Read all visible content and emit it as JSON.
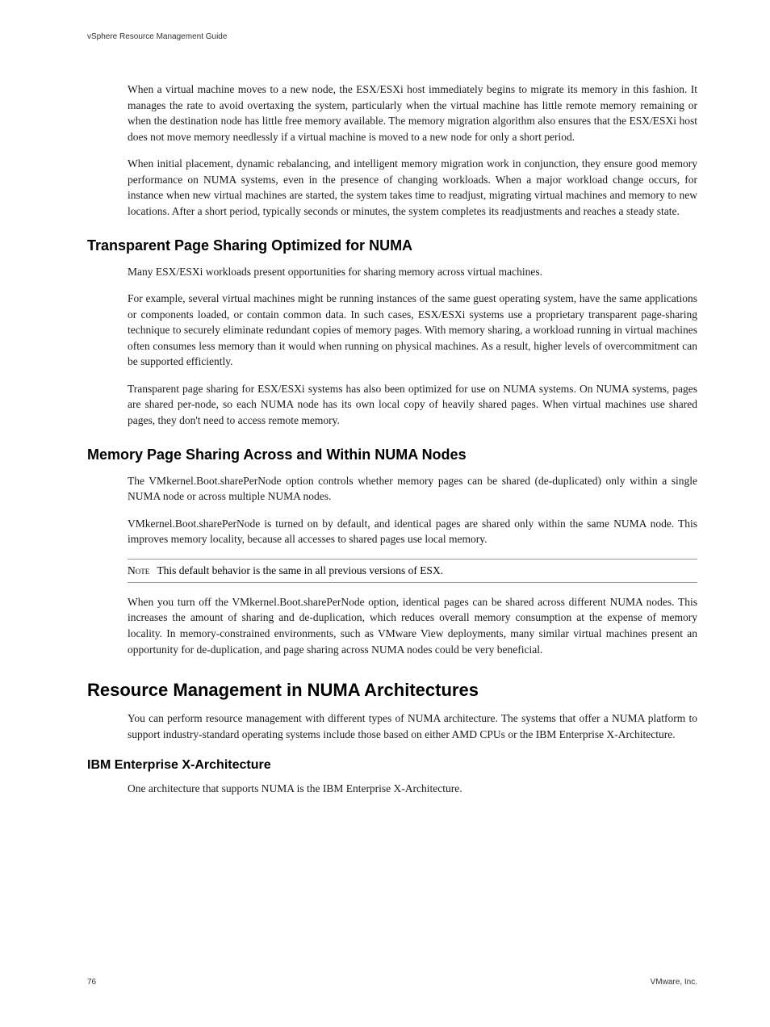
{
  "header": {
    "title": "vSphere Resource Management Guide"
  },
  "body": {
    "para1": "When a virtual machine moves to a new node, the ESX/ESXi host immediately begins to migrate its memory in this fashion. It manages the rate to avoid overtaxing the system, particularly when the virtual machine has little remote memory remaining or when the destination node has little free memory available. The memory migration algorithm also ensures that the ESX/ESXi host does not move memory needlessly if a virtual machine is moved to a new node for only a short period.",
    "para2": "When initial placement, dynamic rebalancing, and intelligent memory migration work in conjunction, they ensure good memory performance on NUMA systems, even in the presence of changing workloads. When a major workload change occurs, for instance when new virtual machines are started, the system takes time to readjust, migrating virtual machines and memory to new locations. After a short period, typically seconds or minutes, the system completes its readjustments and reaches a steady state.",
    "heading1": "Transparent Page Sharing Optimized for NUMA",
    "para3": "Many ESX/ESXi workloads present opportunities for sharing memory across virtual machines.",
    "para4": "For example, several virtual machines might be running instances of the same guest operating system, have the same applications or components loaded, or contain common data. In such cases, ESX/ESXi systems use a proprietary transparent page-sharing technique to securely eliminate redundant copies of memory pages. With memory sharing, a workload running in virtual machines often consumes less memory than it would when running on physical machines. As a result, higher levels of overcommitment can be supported efficiently.",
    "para5": "Transparent page sharing for ESX/ESXi systems has also been optimized for use on NUMA systems. On NUMA systems, pages are shared per-node, so each NUMA node has its own local copy of heavily shared pages. When virtual machines use shared pages, they don't need to access remote memory.",
    "heading2": "Memory Page Sharing Across and Within NUMA Nodes",
    "para6": "The VMkernel.Boot.sharePerNode option controls whether memory pages can be shared (de-duplicated) only within a single NUMA node or across multiple NUMA nodes.",
    "para7": "VMkernel.Boot.sharePerNode is turned on by default, and identical pages are shared only within the same NUMA node. This improves memory locality, because all accesses to shared pages use local memory.",
    "note_label": "Note",
    "note_text": "This default behavior is the same in all previous versions of ESX.",
    "para8": "When you turn off the VMkernel.Boot.sharePerNode option, identical pages can be shared across different NUMA nodes. This increases the amount of sharing and de-duplication, which reduces overall memory consumption at the expense of memory locality. In memory-constrained environments, such as VMware View deployments, many similar virtual machines present an opportunity for de-duplication, and page sharing across NUMA nodes could be very beneficial.",
    "heading3": "Resource Management in NUMA Architectures",
    "para9": "You can perform resource management with different types of NUMA architecture. The systems that offer a NUMA platform to support industry-standard operating systems include those based on either AMD CPUs or the IBM Enterprise X-Architecture.",
    "heading4": "IBM Enterprise X-Architecture",
    "para10": "One architecture that supports NUMA is the IBM Enterprise X-Architecture."
  },
  "footer": {
    "page": "76",
    "company": "VMware, Inc."
  }
}
